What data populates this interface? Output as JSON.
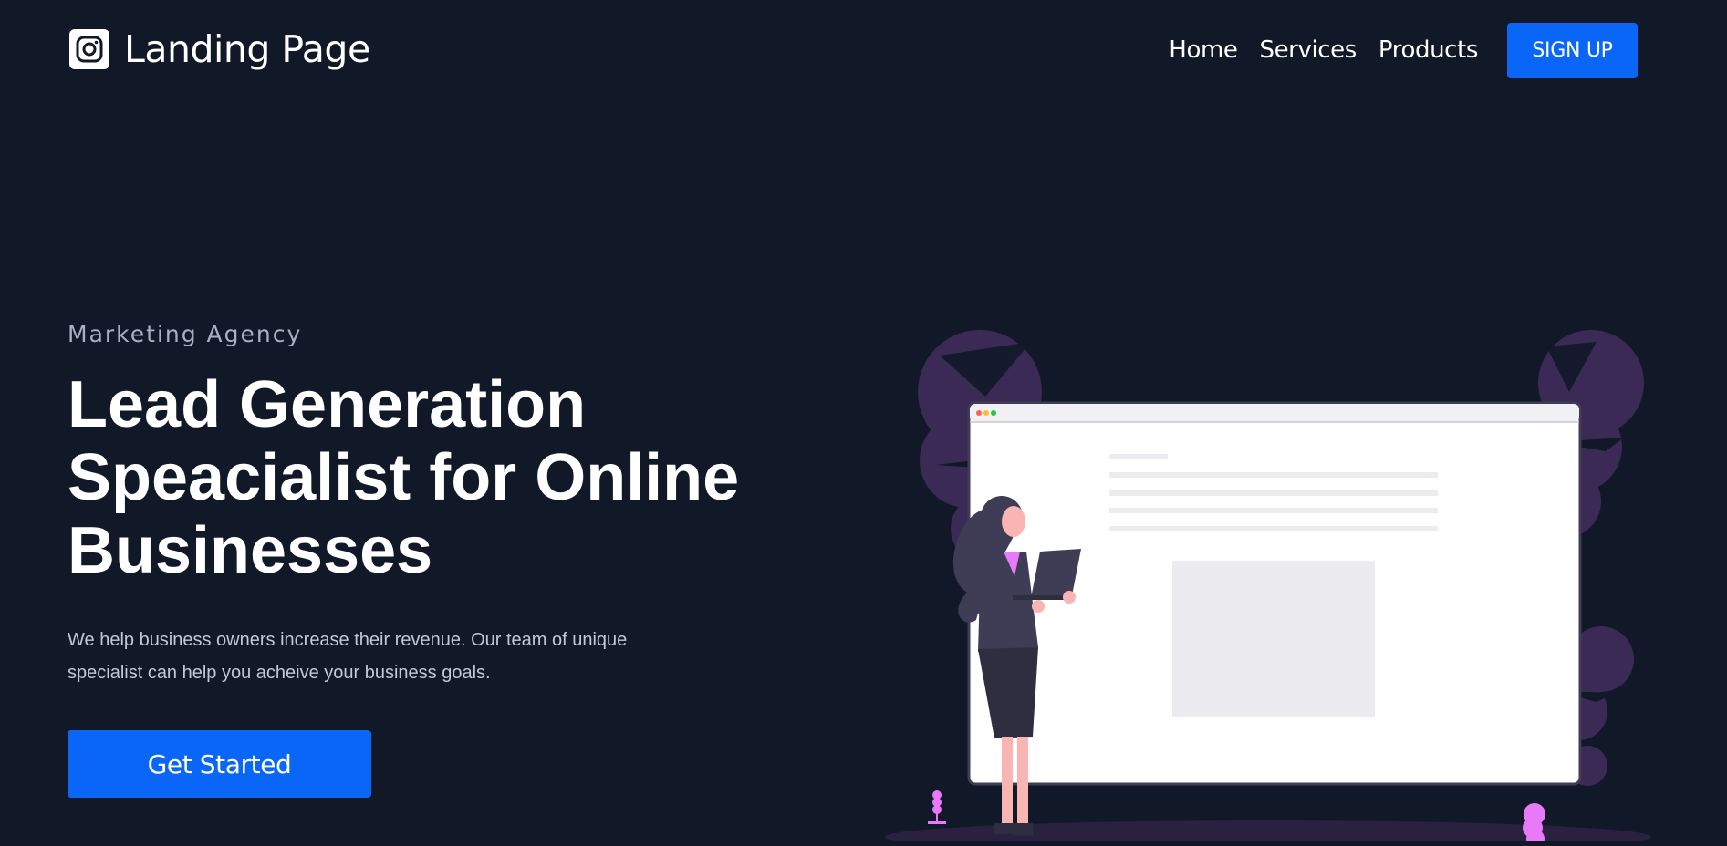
{
  "navbar": {
    "brand_title": "Landing Page",
    "brand_icon": "instagram-icon",
    "links": [
      {
        "label": "Home"
      },
      {
        "label": "Services"
      },
      {
        "label": "Products"
      }
    ],
    "signup_label": "SIGN UP"
  },
  "hero": {
    "eyebrow": "Marketing Agency",
    "headline": "Lead Generation Speacialist for Online Businesses",
    "description": "We help business owners increase their revenue. Our team of unique specialist can help you acheive your business goals.",
    "cta_label": "Get Started"
  },
  "colors": {
    "background": "#111827",
    "accent": "#0a66f7",
    "illustration_purple": "#3b2a55",
    "illustration_pink": "#e879f9"
  }
}
